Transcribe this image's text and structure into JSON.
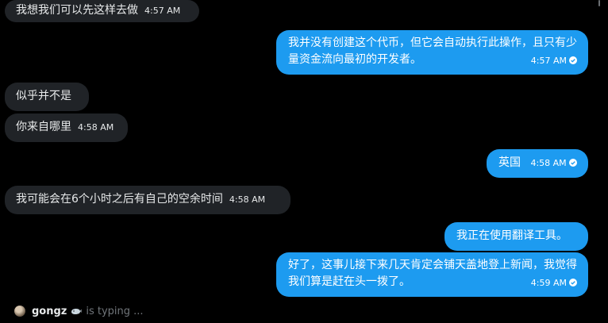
{
  "messages": [
    {
      "direction": "in",
      "text": "我想我们可以先这样去做",
      "time": "4:57 AM"
    },
    {
      "direction": "out",
      "text": "我并没有创建这个代币，但它会自动执行此操作，且只有少量资金流向最初的开发者。",
      "time": "4:57 AM"
    },
    {
      "direction": "in",
      "text": "似乎并不是",
      "time": ""
    },
    {
      "direction": "in",
      "text": "你来自哪里",
      "time": "4:58 AM"
    },
    {
      "direction": "out",
      "text": "英国",
      "time": "4:58 AM"
    },
    {
      "direction": "in",
      "text": "我可能会在6个小时之后有自己的空余时间",
      "time": "4:58 AM"
    },
    {
      "direction": "out",
      "text": "我正在使用翻译工具。",
      "time": ""
    },
    {
      "direction": "out",
      "text": "好了，这事儿接下来几天肯定会铺天盖地登上新闻，我觉得我们算是赶在头一拨了。",
      "time": "4:59 AM"
    }
  ],
  "typing": {
    "user": "gongz",
    "badge_icon": "whale-icon",
    "status": "is typing ..."
  },
  "colors": {
    "background": "#000000",
    "incoming_bubble": "#202327",
    "outgoing_bubble": "#1d9bf0",
    "muted_text": "#71767b"
  }
}
